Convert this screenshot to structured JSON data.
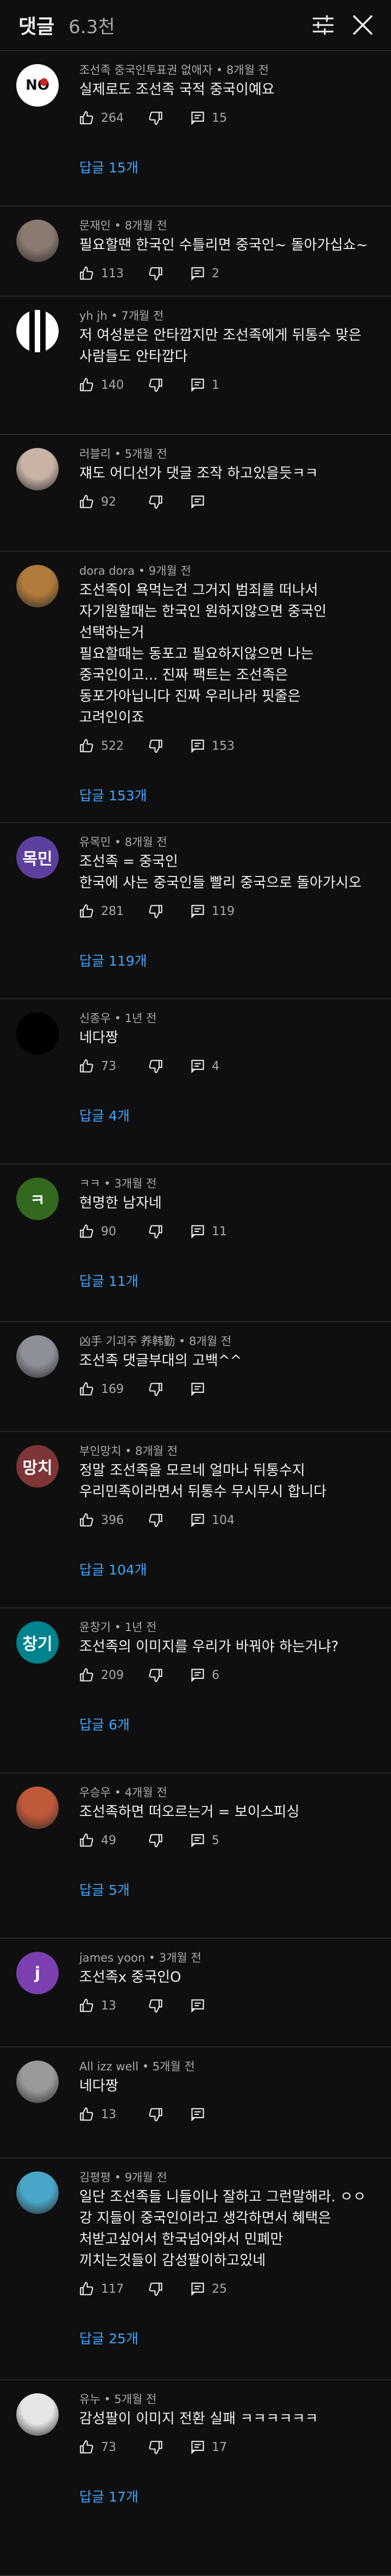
{
  "header": {
    "title": "댓글",
    "count": "6.3천"
  },
  "colors": {
    "link": "#3ea6ff",
    "meta": "#aaaaaa",
    "bg": "#0f0f0f"
  },
  "comments": [
    {
      "meta": "조선족 중국인투표권 없애자 • 8개월 전",
      "text": [
        "실제로도 조선족 국적 중국이예요"
      ],
      "likes": "264",
      "reply_count": "15",
      "replies_link": "답글 15개",
      "avatar": {
        "kind": "no-logo",
        "label": "NO"
      }
    },
    {
      "meta": "문재인 • 8개월 전",
      "text": [
        "필요할땐 한국인 수틀리면 중국인~ 돌아가십쇼~"
      ],
      "likes": "113",
      "reply_count": "2",
      "replies_link": "",
      "avatar": {
        "kind": "photo",
        "color": "#8a7a70"
      }
    },
    {
      "meta": "yh jh • 7개월 전",
      "text": [
        "저 여성분은 안타깝지만 조선족에게 뒤통수 맞은",
        "사람들도 안타깝다"
      ],
      "likes": "140",
      "reply_count": "1",
      "replies_link": "",
      "avatar": {
        "kind": "stripes",
        "color": "#ffffff"
      }
    },
    {
      "meta": "러블리 • 5개월 전",
      "text": [
        "쟤도 어디선가 댓글 조작 하고있을듯ㅋㅋ"
      ],
      "likes": "92",
      "reply_count": "",
      "replies_link": "",
      "avatar": {
        "kind": "photo",
        "color": "#c9b3a6"
      }
    },
    {
      "meta": "dora dora • 9개월 전",
      "text": [
        "조선족이 욕먹는건 그거지 범죄를 떠나서",
        "자기원할때는 한국인 원하지않으면 중국인",
        "선택하는거",
        "필요할때는 동포고 필요하지않으면 나는",
        "중국인이고... 진짜 팩트는 조선족은",
        "동포가아닙니다 진짜 우리나라 핏줄은",
        "고려인이죠"
      ],
      "likes": "522",
      "reply_count": "153",
      "replies_link": "답글 153개",
      "avatar": {
        "kind": "photo",
        "color": "#b07a3a"
      }
    },
    {
      "meta": "유목민 • 8개월 전",
      "text": [
        "조선족 = 중국인",
        "한국에 사는 중국인들 빨리 중국으로 돌아가시오"
      ],
      "likes": "281",
      "reply_count": "119",
      "replies_link": "답글 119개",
      "avatar": {
        "kind": "letters",
        "label": "목민",
        "color": "#5c3f9e"
      }
    },
    {
      "meta": "신종우 • 1년 전",
      "text": [
        "네다짱"
      ],
      "likes": "73",
      "reply_count": "4",
      "replies_link": "답글 4개",
      "avatar": {
        "kind": "photo",
        "color": "#000000"
      }
    },
    {
      "meta": "ㅋㅋ • 3개월 전",
      "text": [
        "현명한 남자네"
      ],
      "likes": "90",
      "reply_count": "11",
      "replies_link": "답글 11개",
      "avatar": {
        "kind": "letters",
        "label": "ㅋ",
        "color": "#33691e"
      }
    },
    {
      "meta": "凶手 기괴주 养韩勤 • 8개월 전",
      "text": [
        "조선족 댓글부대의 고백^^"
      ],
      "likes": "169",
      "reply_count": "",
      "replies_link": "",
      "avatar": {
        "kind": "photo",
        "color": "#8d8f99"
      }
    },
    {
      "meta": "부인망치 • 8개월 전",
      "text": [
        "정말 조선족을 모르네 얼마나 뒤통수지",
        "우리민족이라면서 뒤통수 무시무시 합니다"
      ],
      "likes": "396",
      "reply_count": "104",
      "replies_link": "답글 104개",
      "avatar": {
        "kind": "letters",
        "label": "망치",
        "color": "#7e3537"
      }
    },
    {
      "meta": "윤창기 • 1년 전",
      "text": [
        "조선족의 이미지를 우리가 바꿔야 하는거냐?"
      ],
      "likes": "209",
      "reply_count": "6",
      "replies_link": "답글 6개",
      "avatar": {
        "kind": "letters",
        "label": "창기",
        "color": "#00838f"
      }
    },
    {
      "meta": "우승우 • 4개월 전",
      "text": [
        "조선족하면 떠오르는거 = 보이스피싱"
      ],
      "likes": "49",
      "reply_count": "5",
      "replies_link": "답글 5개",
      "avatar": {
        "kind": "photo",
        "color": "#c0583a"
      }
    },
    {
      "meta": "james yoon • 3개월 전",
      "text": [
        "조선족x 중국인O"
      ],
      "likes": "13",
      "reply_count": "",
      "replies_link": "",
      "avatar": {
        "kind": "letters",
        "label": "j",
        "color": "#7b3fb0"
      }
    },
    {
      "meta": "All izz well • 5개월 전",
      "text": [
        "네다짱"
      ],
      "likes": "13",
      "reply_count": "",
      "replies_link": "",
      "avatar": {
        "kind": "photo",
        "color": "#9a9a9a"
      }
    },
    {
      "meta": "김평평 • 9개월 전",
      "text": [
        "일단 조선족들 니들이나 잘하고 그런말해라. ㅇㅇ",
        "강 지들이 중국인이라고 생각하면서 혜택은",
        "처받고싶어서 한국넘어와서 민폐만",
        "끼치는것들이 감성팔이하고있네"
      ],
      "likes": "117",
      "reply_count": "25",
      "replies_link": "답글 25개",
      "avatar": {
        "kind": "photo",
        "color": "#4aa6c9"
      }
    },
    {
      "meta": "유누 • 5개월 전",
      "text": [
        "감성팔이 이미지 전환 실패 ㅋㅋㅋㅋㅋㅋ"
      ],
      "likes": "73",
      "reply_count": "17",
      "replies_link": "답글 17개",
      "avatar": {
        "kind": "photo",
        "color": "#e6e6e6"
      }
    }
  ]
}
